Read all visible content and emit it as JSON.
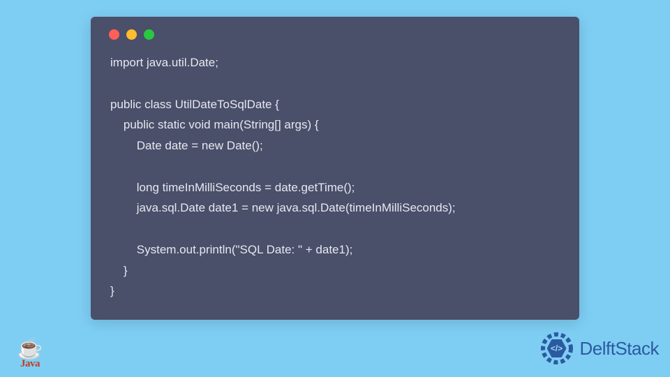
{
  "code": {
    "line1": "import java.util.Date;",
    "line2": "",
    "line3": "public class UtilDateToSqlDate {",
    "line4": "    public static void main(String[] args) {",
    "line5": "        Date date = new Date();",
    "line6": "",
    "line7": "        long timeInMilliSeconds = date.getTime();",
    "line8": "        java.sql.Date date1 = new java.sql.Date(timeInMilliSeconds);",
    "line9": "",
    "line10": "        System.out.println(\"SQL Date: \" + date1);",
    "line11": "    }",
    "line12": "}"
  },
  "window": {
    "dot_red": "#ff5f57",
    "dot_yellow": "#febc2e",
    "dot_green": "#28c840"
  },
  "logos": {
    "java_label": "Java",
    "java_cup": "☕",
    "delft_label": "DelftStack",
    "delft_hex_text": "</>"
  },
  "colors": {
    "page_bg": "#7ecef4",
    "window_bg": "#4a4f6a",
    "code_fg": "#e6e8f0",
    "delft_blue": "#2c5aa0"
  }
}
